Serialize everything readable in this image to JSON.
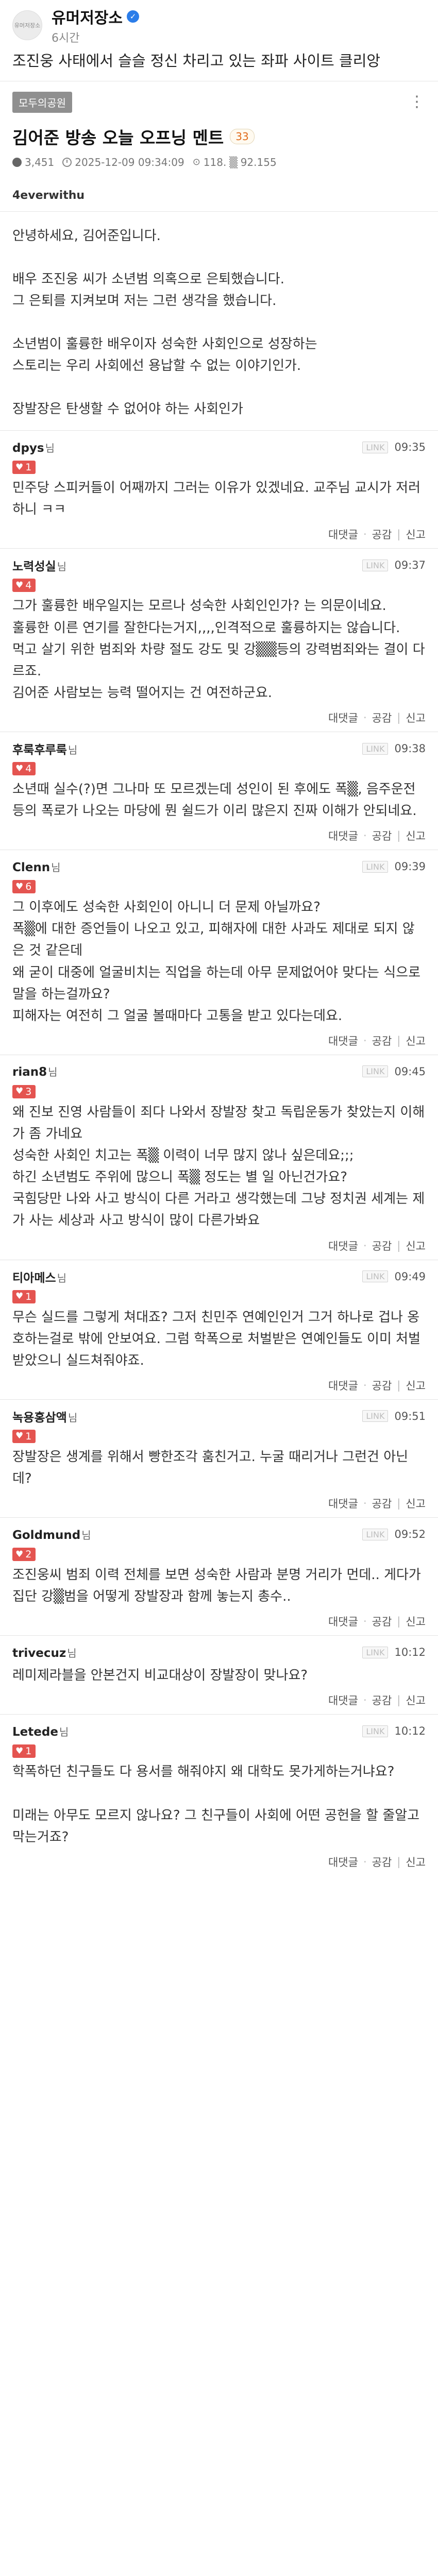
{
  "header": {
    "avatar_label": "유머저장소",
    "name": "유머저장소",
    "time": "6시간",
    "caption": "조진웅 사태에서 슬슬 정신 차리고 있는 좌파 사이트 클리앙"
  },
  "post": {
    "board": "모두의공원",
    "title": "김어준 방송 오늘 오프닝 멘트",
    "comment_count": "33",
    "views": "3,451",
    "datetime": "2025-12-09 09:34:09",
    "ip": "118.",
    "ip_mask": "92.155",
    "author": "4everwithu",
    "body": [
      "안녕하세요, 김어준입니다.",
      "",
      "배우 조진웅 씨가 소년범 의혹으로 은퇴했습니다.",
      "그 은퇴를 지켜보며 저는 그런 생각을 했습니다.",
      "",
      "소년범이 훌륭한 배우이자 성숙한 사회인으로 성장하는",
      "스토리는 우리 사회에선 용납할 수 없는 이야기인가.",
      "",
      "장발장은 탄생할 수 없어야 하는 사회인가"
    ]
  },
  "labels": {
    "nim": "님",
    "link": "LINK",
    "reply": "대댓글",
    "like": "공감",
    "report": "신고",
    "sep": "·",
    "pipe": "|"
  },
  "comments": [
    {
      "author": "dpys",
      "time": "09:35",
      "likes": "1",
      "text": "민주당 스피커들이 어째까지 그러는 이유가 있겠네요. 교주님 교시가 저러하니 ㅋㅋ"
    },
    {
      "author": "노력성실",
      "time": "09:37",
      "likes": "4",
      "text": "그가 훌륭한 배우일지는 모르나 성숙한 사회인인가? 는 의문이네요.\n훌륭한 이른 연기를 잘한다는거지,,,,인격적으로 훌륭하지는 않습니다.\n먹고 살기 위한 범죄와 차량 절도 강도 및 강▒▒등의 강력범죄와는 결이 다르죠.\n김어준 사람보는 능력 떨어지는 건 여전하군요."
    },
    {
      "author": "후룩후루룩",
      "time": "09:38",
      "likes": "4",
      "text": "소년때 실수(?)면 그나마 또 모르겠는데 성인이 된 후에도 폭▒, 음주운전 등의 폭로가 나오는 마당에 뭔 쉴드가 이리 많은지 진짜 이해가 안되네요."
    },
    {
      "author": "Clenn",
      "time": "09:39",
      "likes": "6",
      "text": "그 이후에도 성숙한 사회인이 아니니 더 문제 아닐까요?\n폭▒에 대한 증언들이 나오고 있고, 피해자에 대한 사과도 제대로 되지 않은 것 같은데\n왜 굳이 대중에 얼굴비치는 직업을 하는데 아무 문제없어야 맞다는 식으로 말을 하는걸까요?\n피해자는 여전히 그 얼굴 볼때마다 고통을 받고 있다는데요."
    },
    {
      "author": "rian8",
      "time": "09:45",
      "likes": "3",
      "text": "왜 진보 진영 사람들이 죄다 나와서 장발장 찾고 독립운동가 찾았는지 이해가 좀 가네요\n성숙한 사회인 치고는 폭▒ 이력이 너무 많지 않나 싶은데요;;;\n하긴 소년범도 주위에 많으니 폭▒ 정도는 별 일 아닌건가요?\n국힘당만 나와 사고 방식이 다른 거라고 생각했는데 그냥 정치권 세계는 제가 사는 세상과 사고 방식이 많이 다른가봐요"
    },
    {
      "author": "티아메스",
      "time": "09:49",
      "likes": "1",
      "text": "무슨 실드를 그렇게 쳐대죠? 그저 친민주 연예인인거 그거 하나로 겁나 옹호하는걸로 밖에 안보여요. 그럼 학폭으로 처벌받은 연예인들도 이미 처벌 받았으니 실드쳐줘야죠."
    },
    {
      "author": "녹용홍삼액",
      "time": "09:51",
      "likes": "1",
      "text": "장발장은 생계를 위해서 빵한조각 훔친거고. 누굴 때리거나 그런건 아닌데?"
    },
    {
      "author": "Goldmund",
      "time": "09:52",
      "likes": "2",
      "text": "조진웅씨 범죄 이력 전체를 보면 성숙한 사람과 분명 거리가 먼데.. 게다가 집단 강▒범을 어떻게 장발장과 함께 놓는지 총수.."
    },
    {
      "author": "trivecuz",
      "time": "10:12",
      "likes": "",
      "text": "레미제라블을 안본건지 비교대상이 장발장이 맞나요?"
    },
    {
      "author": "Letede",
      "time": "10:12",
      "likes": "1",
      "text": "학폭하던 친구들도 다 용서를 해줘야지 왜 대학도 못가게하는거냐요?\n\n미래는 아무도 모르지 않나요? 그 친구들이 사회에 어떤 공헌을 할 줄알고 막는거죠?"
    }
  ]
}
